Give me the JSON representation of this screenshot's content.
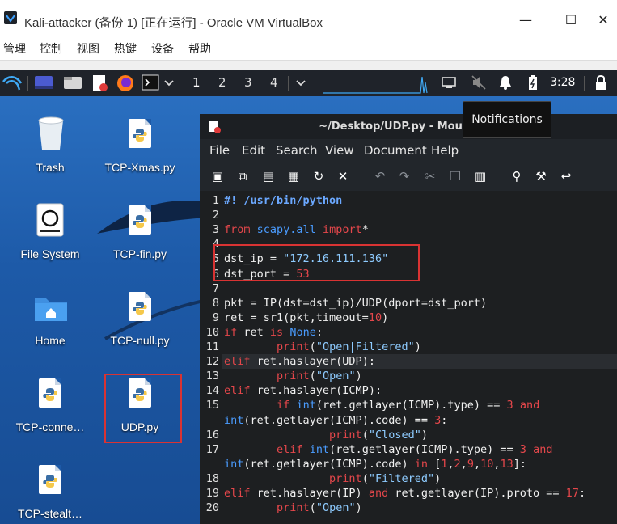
{
  "window": {
    "title": "Kali-attacker (备份 1) [正在运行] - Oracle VM VirtualBox",
    "minimize": "—",
    "maximize": "☐",
    "close": "✕"
  },
  "vbox_menu": [
    "管理",
    "控制",
    "视图",
    "热键",
    "设备",
    "帮助"
  ],
  "panel": {
    "workspaces": [
      "1",
      "2",
      "3",
      "4"
    ],
    "clock": "3:28"
  },
  "tooltip": "Notifications",
  "desktop_icons": [
    {
      "label": "Trash"
    },
    {
      "label": "TCP-Xmas.py"
    },
    {
      "label": "File System"
    },
    {
      "label": "TCP-fin.py"
    },
    {
      "label": "Home"
    },
    {
      "label": "TCP-null.py"
    },
    {
      "label": "TCP-conne…"
    },
    {
      "label": "UDP.py"
    },
    {
      "label": "TCP-stealt…"
    }
  ],
  "editor_window": {
    "title": "~/Desktop/UDP.py - Mousepad",
    "menu": [
      "File",
      "Edit",
      "Search",
      "View",
      "Document",
      "Help"
    ]
  },
  "code_lines": [
    {
      "n": "1",
      "html": "<span class='c'>#! /usr/bin/python</span>"
    },
    {
      "n": "2",
      "html": ""
    },
    {
      "n": "3",
      "html": "<span class='k'>from</span> <span class='b'>scapy.all</span> <span class='k'>import</span>*"
    },
    {
      "n": "4",
      "html": ""
    },
    {
      "n": "5",
      "html": "dst_ip = <span class='s'>\"172.16.111.136\"</span>"
    },
    {
      "n": "6",
      "html": "dst_port = <span class='n'>53</span>"
    },
    {
      "n": "7",
      "html": ""
    },
    {
      "n": "8",
      "html": "pkt = IP(dst=dst_ip)/UDP(dport=dst_port)"
    },
    {
      "n": "9",
      "html": "ret = sr1(pkt,timeout=<span class='n'>10</span>)"
    },
    {
      "n": "10",
      "html": "<span class='k'>if</span> ret <span class='k'>is</span> <span class='b'>None</span>:"
    },
    {
      "n": "11",
      "html": "        <span class='k'>print</span>(<span class='s'>\"Open|Filtered\"</span>)"
    },
    {
      "n": "12",
      "html": "<span class='k'>elif</span> ret.haslayer(UDP):"
    },
    {
      "n": "13",
      "html": "        <span class='k'>print</span>(<span class='s'>\"Open\"</span>)"
    },
    {
      "n": "14",
      "html": "<span class='k'>elif</span> ret.haslayer(ICMP):"
    },
    {
      "n": "15",
      "html": "        <span class='k'>if</span> <span class='b'>int</span>(ret.getlayer(ICMP).type) == <span class='n'>3</span> <span class='k'>and</span>"
    },
    {
      "n": "",
      "html": "<span class='b'>int</span>(ret.getlayer(ICMP).code) == <span class='n'>3</span>:"
    },
    {
      "n": "16",
      "html": "                <span class='k'>print</span>(<span class='s'>\"Closed\"</span>)"
    },
    {
      "n": "17",
      "html": "        <span class='k'>elif</span> <span class='b'>int</span>(ret.getlayer(ICMP).type) == <span class='n'>3</span> <span class='k'>and</span>"
    },
    {
      "n": "",
      "html": "<span class='b'>int</span>(ret.getlayer(ICMP).code) <span class='k'>in</span> [<span class='n'>1</span>,<span class='n'>2</span>,<span class='n'>9</span>,<span class='n'>10</span>,<span class='n'>13</span>]:"
    },
    {
      "n": "18",
      "html": "                <span class='k'>print</span>(<span class='s'>\"Filtered\"</span>)"
    },
    {
      "n": "19",
      "html": "<span class='k'>elif</span> ret.haslayer(IP) <span class='k'>and</span> ret.getlayer(IP).proto == <span class='n'>17</span>:"
    },
    {
      "n": "20",
      "html": "        <span class='k'>print</span>(<span class='s'>\"Open\"</span>)"
    }
  ]
}
